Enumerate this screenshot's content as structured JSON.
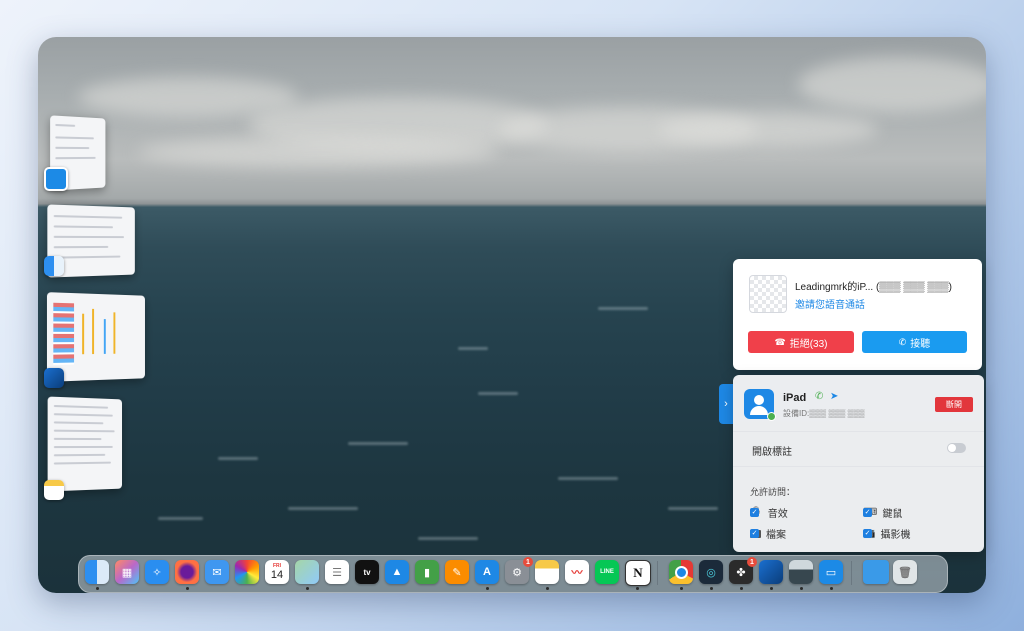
{
  "call_notification": {
    "caller": "Leadingmrk的iP... (▒▒▒ ▒▒▒ ▒▒▒)",
    "subtitle": "邀請您語音通話",
    "reject_label": "拒絕(33)",
    "accept_label": "接聽"
  },
  "device_panel": {
    "device_name": "iPad",
    "device_id": "設備ID:▒▒▒ ▒▒▒ ▒▒▒",
    "disconnect_label": "斷開",
    "annotation_label": "開啟標註",
    "annotation_enabled": false,
    "permissions_title": "允許訪問：",
    "permissions": [
      {
        "label": "音效",
        "icon": "microphone-icon",
        "checked": true
      },
      {
        "label": "鍵鼠",
        "icon": "keyboard-icon",
        "checked": true
      },
      {
        "label": "檔案",
        "icon": "folder-icon",
        "checked": true
      },
      {
        "label": "攝影機",
        "icon": "camera-icon",
        "checked": true
      }
    ]
  },
  "dock": {
    "calendar_month": "FRI",
    "calendar_day": "14",
    "tv_label": "tv",
    "system_settings_badge": "1",
    "game_badge": "1",
    "line_label": "LINE",
    "notion_label": "N"
  },
  "colors": {
    "accent": "#1e88e5",
    "reject": "#f0404a",
    "accept": "#1a9bf0",
    "disconnect": "#e2363c"
  }
}
